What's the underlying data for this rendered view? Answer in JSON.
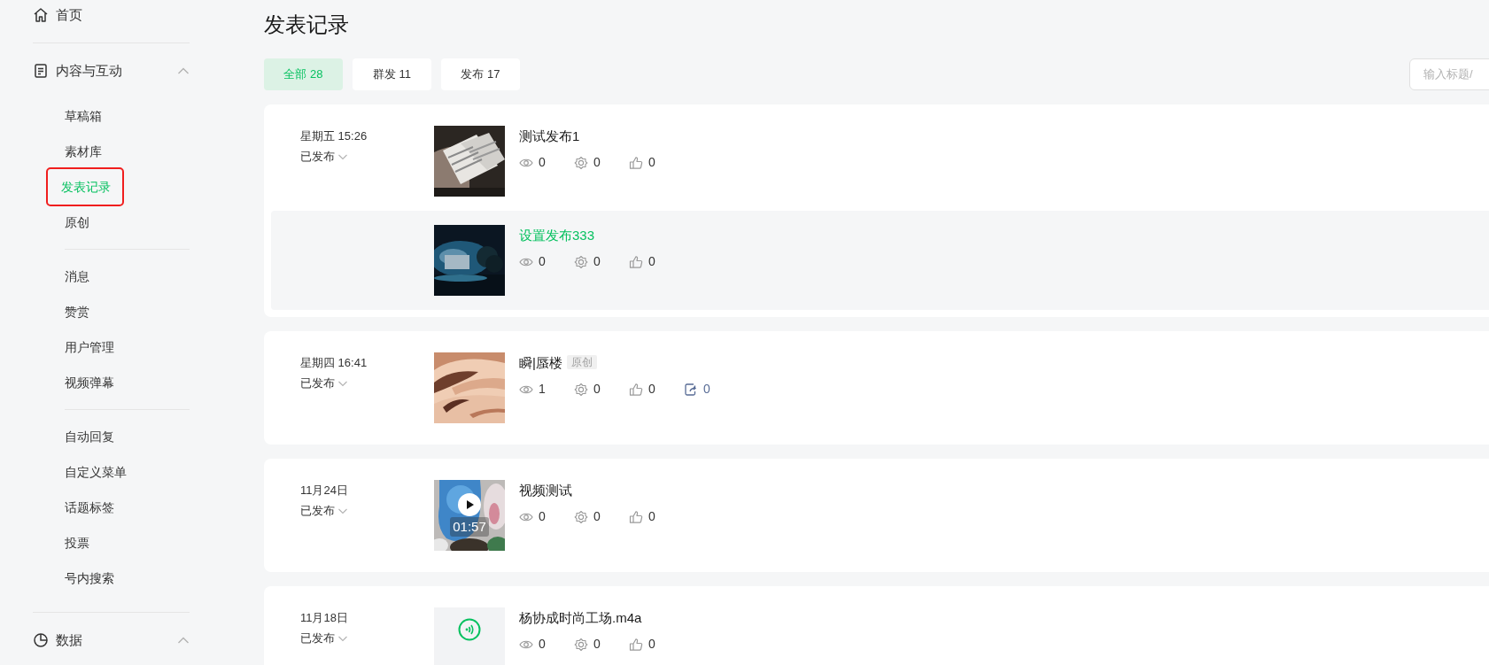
{
  "sidebar": {
    "sections": [
      {
        "kind": "home",
        "label": "首页"
      },
      {
        "kind": "content",
        "label": "内容与互动",
        "expanded": true,
        "groups": [
          [
            {
              "label": "草稿箱",
              "selected": false,
              "annotated": false
            },
            {
              "label": "素材库",
              "selected": false,
              "annotated": false
            },
            {
              "label": "发表记录",
              "selected": true,
              "annotated": true
            },
            {
              "label": "原创",
              "selected": false,
              "annotated": false
            }
          ],
          [
            {
              "label": "消息",
              "selected": false,
              "annotated": false
            },
            {
              "label": "赞赏",
              "selected": false,
              "annotated": false
            },
            {
              "label": "用户管理",
              "selected": false,
              "annotated": false
            },
            {
              "label": "视频弹幕",
              "selected": false,
              "annotated": false
            }
          ],
          [
            {
              "label": "自动回复",
              "selected": false,
              "annotated": false
            },
            {
              "label": "自定义菜单",
              "selected": false,
              "annotated": false
            },
            {
              "label": "话题标签",
              "selected": false,
              "annotated": false
            },
            {
              "label": "投票",
              "selected": false,
              "annotated": false
            },
            {
              "label": "号内搜索",
              "selected": false,
              "annotated": false
            }
          ]
        ]
      },
      {
        "kind": "data",
        "label": "数据",
        "expanded": true
      }
    ]
  },
  "page_title": "发表记录",
  "filter_tabs": [
    {
      "label": "全部 28",
      "selected": true
    },
    {
      "label": "群发 11",
      "selected": false
    },
    {
      "label": "发布 17",
      "selected": false
    }
  ],
  "search": {
    "placeholder": "输入标题/"
  },
  "records": [
    {
      "date": "星期五 15:26",
      "status": "已发布",
      "articles": [
        {
          "title": "测试发布1",
          "hovered": false,
          "thumbnail": {
            "kind": "picture"
          },
          "stats": [
            {
              "kind": "views",
              "value": "0"
            },
            {
              "kind": "shares",
              "value": "0"
            },
            {
              "kind": "likes",
              "value": "0"
            }
          ]
        },
        {
          "title": "设置发布333",
          "hovered": true,
          "thumbnail": {
            "kind": "picture"
          },
          "stats": [
            {
              "kind": "views",
              "value": "0"
            },
            {
              "kind": "shares",
              "value": "0"
            },
            {
              "kind": "likes",
              "value": "0"
            }
          ]
        }
      ]
    },
    {
      "date": "星期四 16:41",
      "status": "已发布",
      "articles": [
        {
          "title": "瞬|蜃楼",
          "tag": "原创",
          "hovered": false,
          "thumbnail": {
            "kind": "picture"
          },
          "stats": [
            {
              "kind": "views",
              "value": "1"
            },
            {
              "kind": "shares",
              "value": "0"
            },
            {
              "kind": "likes",
              "value": "0"
            },
            {
              "kind": "forwards",
              "value": "0"
            }
          ]
        }
      ]
    },
    {
      "date": "11月24日",
      "status": "已发布",
      "articles": [
        {
          "title": "视频测试",
          "hovered": false,
          "thumbnail": {
            "kind": "video",
            "duration": "01:57"
          },
          "stats": [
            {
              "kind": "views",
              "value": "0"
            },
            {
              "kind": "shares",
              "value": "0"
            },
            {
              "kind": "likes",
              "value": "0"
            }
          ]
        }
      ]
    },
    {
      "date": "11月18日",
      "status": "已发布",
      "articles": [
        {
          "title": "杨协成时尚工场.m4a",
          "hovered": false,
          "thumbnail": {
            "kind": "audio"
          },
          "stats": [
            {
              "kind": "views",
              "value": "0"
            },
            {
              "kind": "shares",
              "value": "0"
            },
            {
              "kind": "likes",
              "value": "0"
            }
          ]
        }
      ]
    }
  ]
}
